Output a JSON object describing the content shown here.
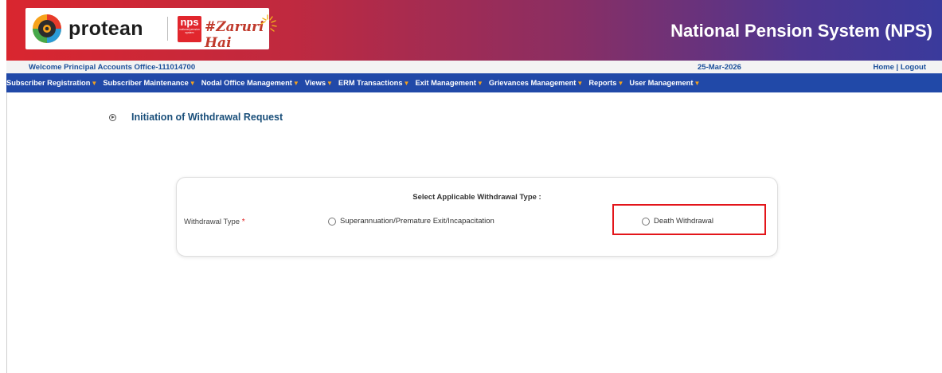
{
  "header": {
    "brand_name": "protean",
    "nps_badge_big": "nps",
    "nps_badge_small": "national pension system",
    "tagline": "#Zaruri Hai",
    "site_title": "National Pension System (NPS)"
  },
  "welcome_bar": {
    "welcome_text": "Welcome Principal Accounts Office-111014700",
    "date": "25-Mar-2026",
    "home_link": "Home",
    "separator": " | ",
    "logout_link": "Logout"
  },
  "nav": {
    "items": [
      {
        "label": "Subscriber Registration"
      },
      {
        "label": "Subscriber Maintenance"
      },
      {
        "label": "Nodal Office Management"
      },
      {
        "label": "Views"
      },
      {
        "label": "ERM Transactions"
      },
      {
        "label": "Exit Management"
      },
      {
        "label": "Grievances Management"
      },
      {
        "label": "Reports"
      },
      {
        "label": "User Management"
      }
    ],
    "caret_glyph": "▼"
  },
  "page": {
    "heading": "Initiation of Withdrawal Request"
  },
  "withdrawal_form": {
    "title": "Select Applicable Withdrawal Type :",
    "field_label": "Withdrawal Type",
    "required_mark": "*",
    "options": [
      {
        "label": "Superannuation/Premature Exit/Incapacitation",
        "selected": false
      },
      {
        "label": "Death Withdrawal",
        "selected": false
      }
    ]
  },
  "colors": {
    "banner_start": "#d9262f",
    "banner_end": "#3a3a9c",
    "nav_bg": "#2149a8",
    "caret": "#f0a020",
    "heading_text": "#1a4f7a",
    "highlight": "#e3151a",
    "required": "#e02020"
  },
  "icons": {
    "brand": "protean-logo-icon",
    "heading_bullet": "circle-play-icon",
    "radio": "radio-unchecked-icon"
  }
}
